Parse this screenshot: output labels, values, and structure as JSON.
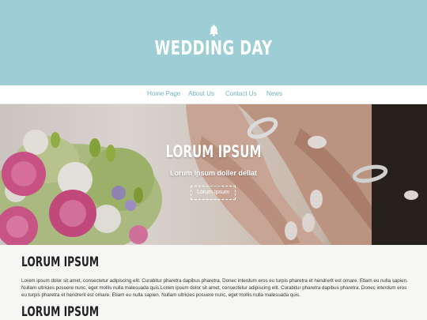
{
  "brand": {
    "title": "WEDDING DAY",
    "icon": "bell-icon"
  },
  "nav": {
    "items": [
      "Home Page",
      "About Us",
      "Contact Us",
      "News"
    ]
  },
  "hero": {
    "title": "LORUM IPSUM",
    "subtitle": "Lorum Ipsum doller dellat",
    "button_label": "Lorum Ipsum"
  },
  "sections": [
    {
      "title": "LORUM IPSUM",
      "body": "Lorem ipsum dolor sit amet, consectetur adipiscing elit. Curabitur pharetra dapibus pharetra. Donec interdum eros eu turpis pharetra et hendrerit est ornare. Etiam eu nulla sapien. Nullam ultricies posuere nunc, eget mollis nulla malesuada quis.Lorem ipsum dolor sit amet, consectetur adipiscing elit. Curabitur pharetra dapibus pharetra. Donec interdum eros eu turpis pharetra et hendrerit est ornare. Etiam eu nulla sapien. Nullam ultricies posuere nunc, eget mollis nulla malesuada quis."
    },
    {
      "title": "LORUM IPSUM"
    }
  ],
  "colors": {
    "header_bg": "#9dced6",
    "nav_link": "#6fb3bd",
    "content_bg": "#f6f6f4"
  }
}
